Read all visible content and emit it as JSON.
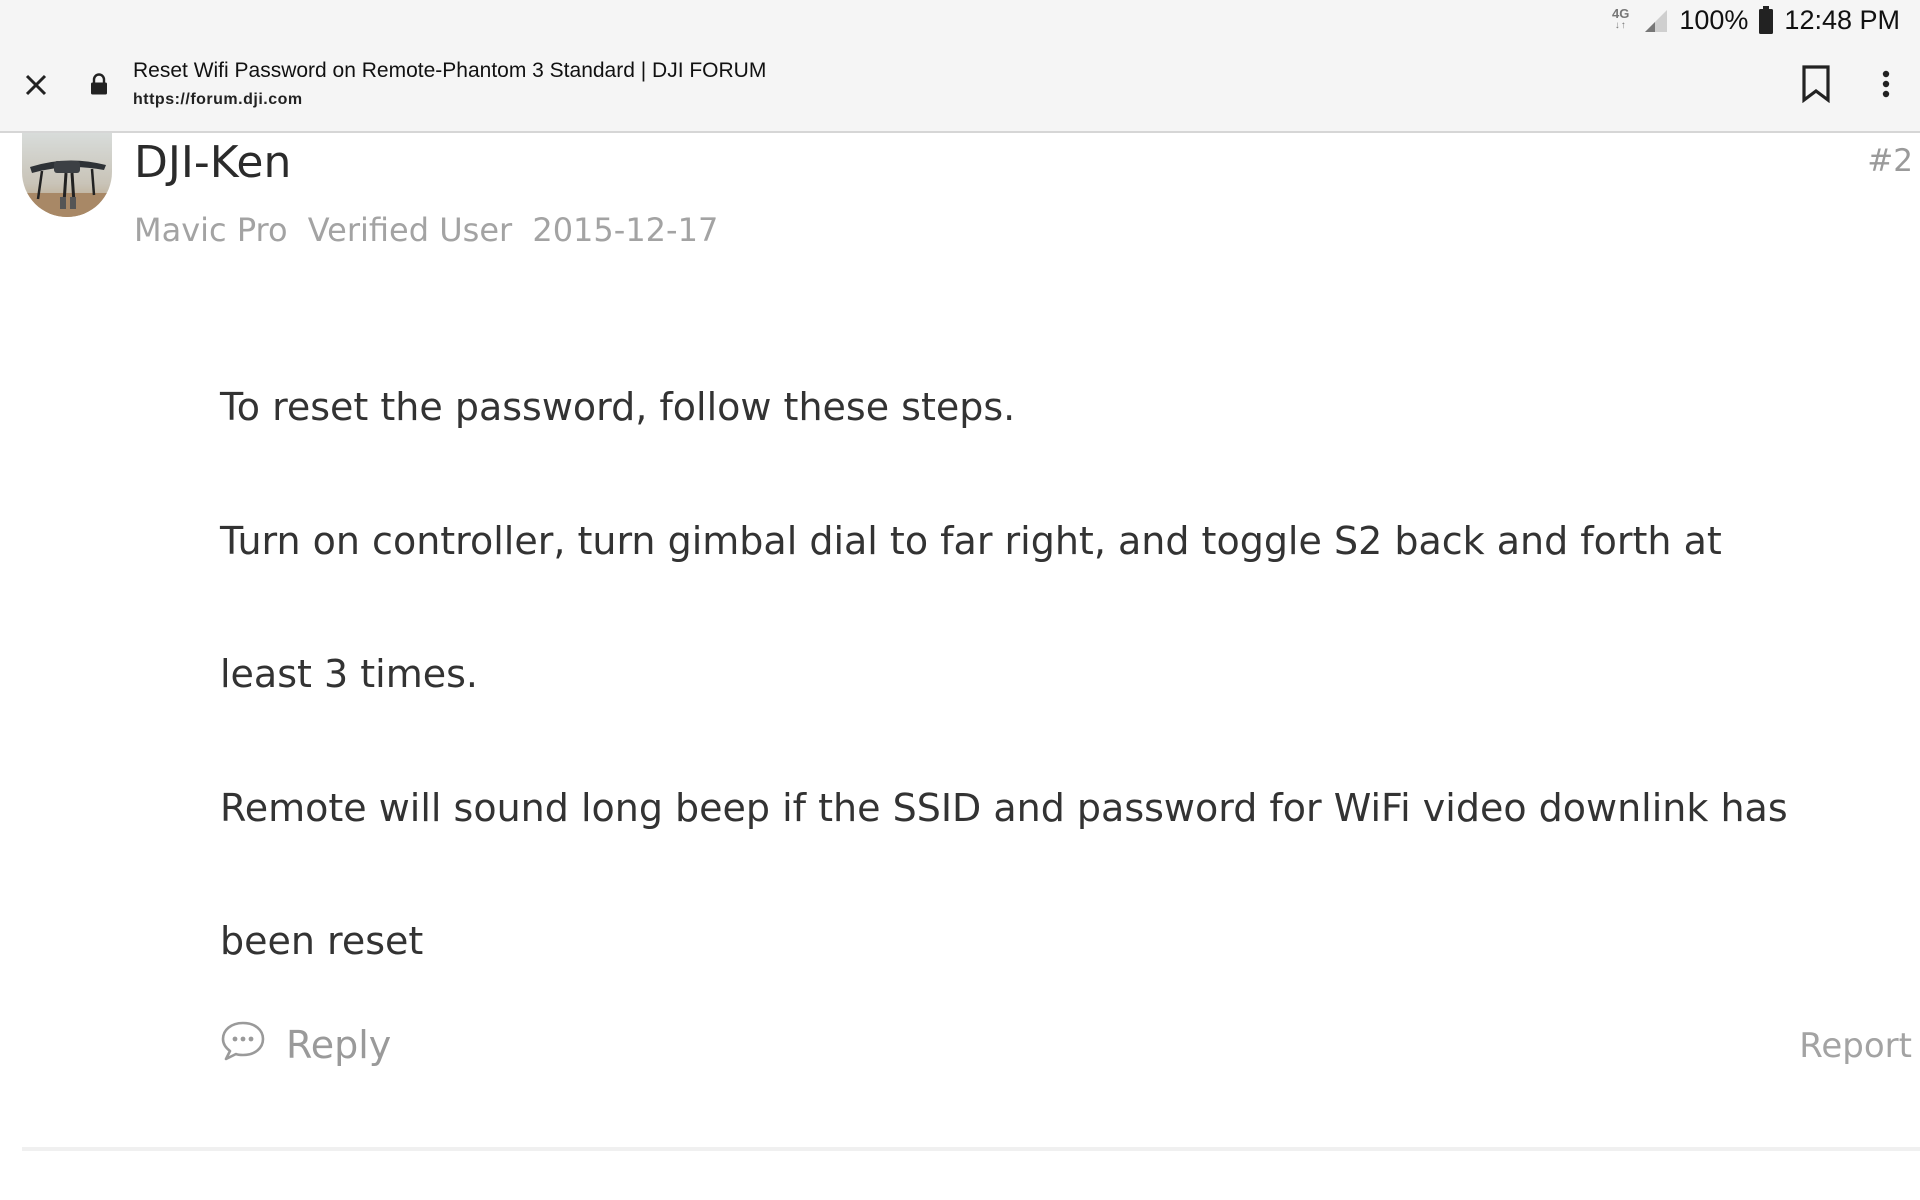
{
  "status_bar": {
    "network_type": "4G",
    "battery_percent": "100%",
    "time": "12:48 PM",
    "icons": [
      "4g-icon",
      "signal-icon",
      "battery-icon"
    ]
  },
  "toolbar": {
    "page_title": "Reset Wifi Password on Remote-Phantom 3 Standard | DJI FORUM",
    "url": "https://forum.dji.com",
    "icons": [
      "close-icon",
      "lock-icon",
      "bookmark-icon",
      "more-vert-icon"
    ]
  },
  "post": {
    "author": "DJI-Ken",
    "post_number": "#2",
    "meta": {
      "device": "Mavic Pro",
      "badge": "Verified User",
      "date": "2015-12-17"
    },
    "body": [
      "To reset the password, follow these steps.",
      "Turn on controller, turn gimbal dial to far right, and toggle S2 back and forth at least 3 times.",
      "Remote will sound long beep if the SSID and password for WiFi video downlink has been reset"
    ],
    "reply_label": "Reply",
    "report_label": "Report"
  },
  "colors": {
    "chrome_background": "#f5f5f5",
    "text_primary": "#333333",
    "text_muted": "#a3a3a3"
  }
}
